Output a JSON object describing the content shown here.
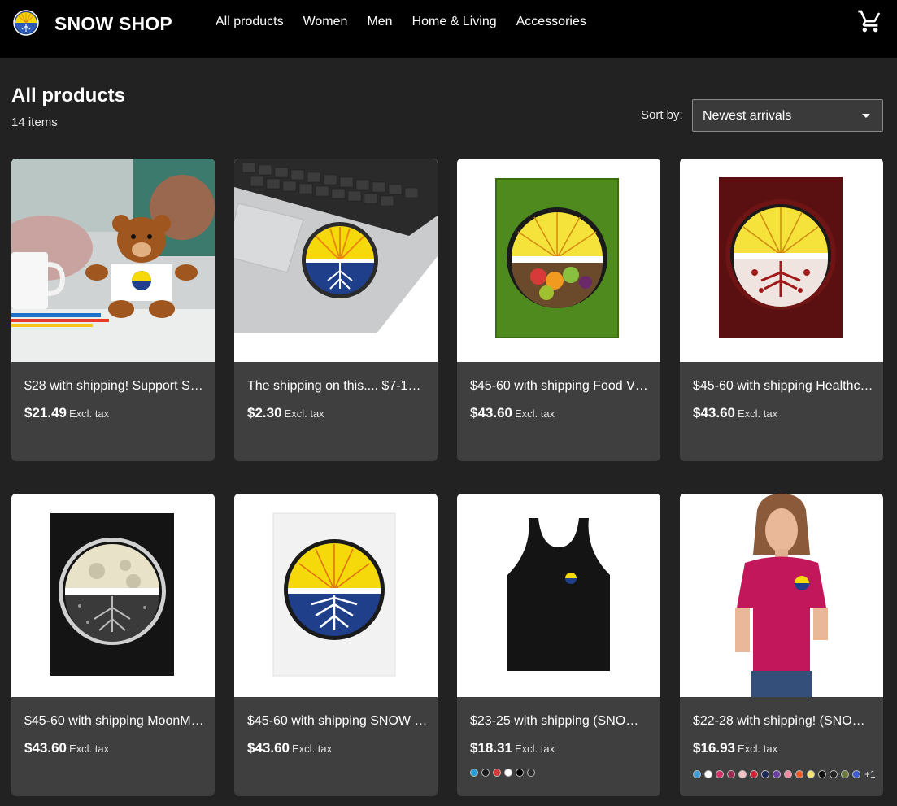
{
  "header": {
    "brand": "SNOW SHOP",
    "nav": [
      "All products",
      "Women",
      "Men",
      "Home & Living",
      "Accessories"
    ]
  },
  "page": {
    "title": "All products",
    "item_count": "14 items",
    "sort_label": "Sort by:",
    "sort_value": "Newest arrivals"
  },
  "products": [
    {
      "title": "$28 with shipping! Support S…",
      "price": "$21.49",
      "tax": "Excl. tax"
    },
    {
      "title": "The shipping on this.... $7-10…",
      "price": "$2.30",
      "tax": "Excl. tax"
    },
    {
      "title": "$45-60 with shipping Food V…",
      "price": "$43.60",
      "tax": "Excl. tax"
    },
    {
      "title": "$45-60 with shipping Healthc…",
      "price": "$43.60",
      "tax": "Excl. tax"
    },
    {
      "title": "$45-60 with shipping MoonM…",
      "price": "$43.60",
      "tax": "Excl. tax"
    },
    {
      "title": "$45-60 with shipping SNOW …",
      "price": "$43.60",
      "tax": "Excl. tax"
    },
    {
      "title": "$23-25 with shipping (SNOW…",
      "price": "$18.31",
      "tax": "Excl. tax",
      "swatches": [
        "#2a9fd6",
        "#1a1a1a",
        "#d83a3a",
        "#ffffff",
        "#000000",
        "#2b2b2b"
      ]
    },
    {
      "title": "$22-28 with shipping! (SNO…",
      "price": "$16.93",
      "tax": "Excl. tax",
      "swatches": [
        "#3a9bd5",
        "#ffffff",
        "#d6336c",
        "#9a2b4f",
        "#f4c2c2",
        "#cc2233",
        "#1c2a5a",
        "#6b3fa0",
        "#f08aa0",
        "#f05a28",
        "#f5e56b",
        "#111111",
        "#222222",
        "#6b7a3a",
        "#3f5bd6"
      ],
      "more": "+1"
    }
  ]
}
